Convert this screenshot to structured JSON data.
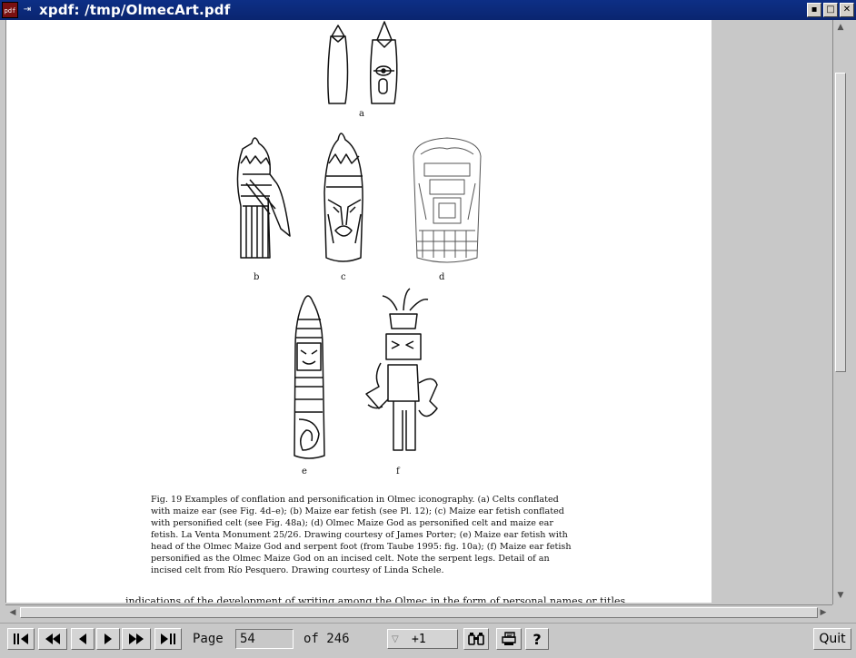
{
  "window": {
    "title": "xpdf: /tmp/OlmecArt.pdf",
    "app_icon_text": "pdf",
    "pin_symbol": "⇥",
    "buttons": {
      "iconify": "▪",
      "maximize": "□",
      "close": "✕"
    }
  },
  "document": {
    "figure_labels": [
      "a",
      "b",
      "c",
      "d",
      "e",
      "f"
    ],
    "caption": "Fig. 19  Examples of conflation and personification in Olmec iconography. (a) Celts conflated with maize ear (see Fig. 4d–e); (b) Maize ear fetish (see Pl. 12); (c) Maize ear fetish conflated with personified celt (see Fig. 48a); (d) Olmec Maize God as personified celt and maize ear fetish. La Venta Monument 25/26. Drawing courtesy of James Porter; (e) Maize ear fetish with head of the Olmec Maize God and serpent foot (from Taube 1995: fig. 10a); (f) Maize ear fetish personified as the Olmec Maize God on an incised celt. Note the serpent legs. Detail of an incised celt from Río Pesquero. Drawing courtesy of Linda Schele.",
    "body_text": "indications of the development of writing among the Olmec in the form of personal names or titles"
  },
  "toolbar": {
    "first_page_icon": "first-page-icon",
    "back_ten_icon": "back-ten-icon",
    "prev_icon": "prev-page-icon",
    "next_icon": "next-page-icon",
    "forward_ten_icon": "forward-ten-icon",
    "last_page_icon": "last-page-icon",
    "page_label": "Page",
    "page_value": "54",
    "of_label": "of 246",
    "zoom_value": "+1",
    "find_icon": "find-icon",
    "print_icon": "print-icon",
    "help_label": "?",
    "quit_label": "Quit"
  }
}
